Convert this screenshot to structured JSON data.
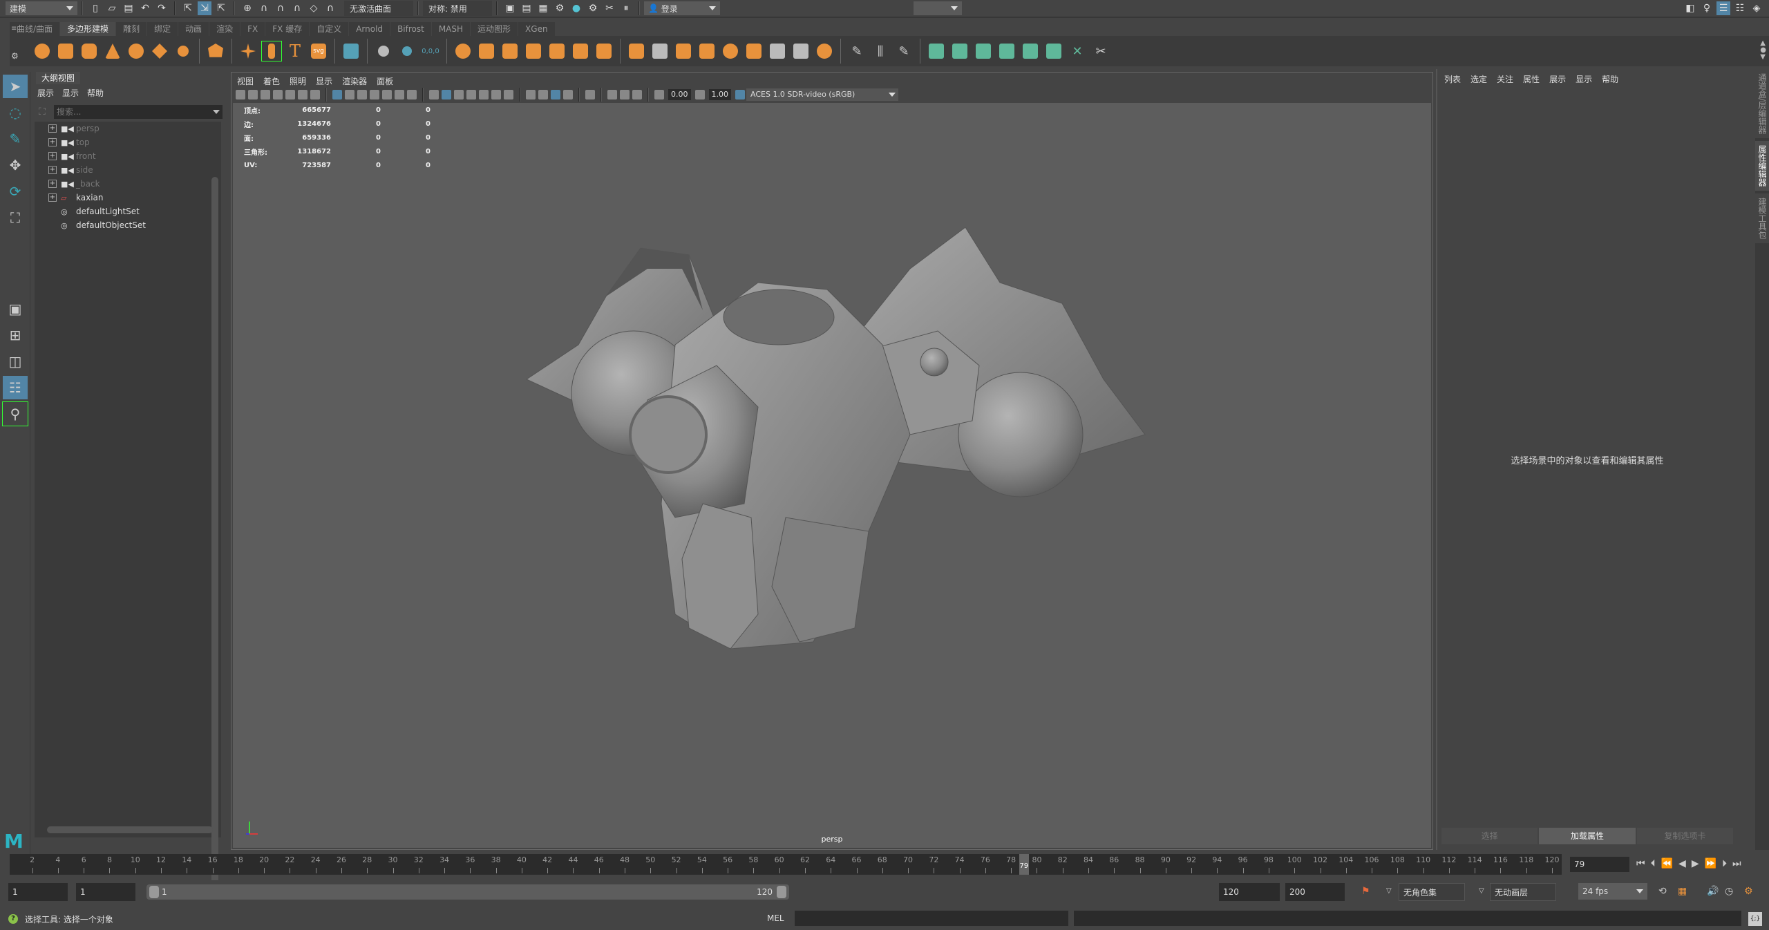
{
  "statusline": {
    "menu_set": "建模",
    "live_surface": "无激活曲面",
    "symmetry": "对称: 禁用",
    "login": "登录"
  },
  "shelf": {
    "tabs": [
      {
        "label": "曲线/曲面",
        "active": false
      },
      {
        "label": "多边形建模",
        "active": true
      },
      {
        "label": "雕刻",
        "active": false
      },
      {
        "label": "绑定",
        "active": false
      },
      {
        "label": "动画",
        "active": false
      },
      {
        "label": "渲染",
        "active": false
      },
      {
        "label": "FX",
        "active": false
      },
      {
        "label": "FX 缓存",
        "active": false
      },
      {
        "label": "自定义",
        "active": false
      },
      {
        "label": "Arnold",
        "active": false
      },
      {
        "label": "Bifrost",
        "active": false
      },
      {
        "label": "MASH",
        "active": false
      },
      {
        "label": "运动图形",
        "active": false
      },
      {
        "label": "XGen",
        "active": false
      }
    ],
    "text_icon": "T",
    "svg_icon": "svg"
  },
  "outliner": {
    "title": "大纲视图",
    "menu": [
      "展示",
      "显示",
      "帮助"
    ],
    "search_placeholder": "搜索...",
    "items": [
      {
        "label": "persp",
        "type": "camera",
        "dim": true
      },
      {
        "label": "top",
        "type": "camera",
        "dim": true
      },
      {
        "label": "front",
        "type": "camera",
        "dim": true
      },
      {
        "label": "side",
        "type": "camera",
        "dim": true
      },
      {
        "label": "_back",
        "type": "camera",
        "dim": true
      },
      {
        "label": "kaxian",
        "type": "transform",
        "dim": false
      },
      {
        "label": "defaultLightSet",
        "type": "set",
        "dim": false
      },
      {
        "label": "defaultObjectSet",
        "type": "set",
        "dim": false
      }
    ]
  },
  "viewport": {
    "menu": [
      "视图",
      "着色",
      "照明",
      "显示",
      "渲染器",
      "面板"
    ],
    "exposure": "0.00",
    "gamma": "1.00",
    "color_management": "ACES 1.0 SDR-video (sRGB)",
    "camera": "persp",
    "hud": [
      {
        "label": "顶点:",
        "value": "665677",
        "sel": "0",
        "tri": "0"
      },
      {
        "label": "边:",
        "value": "1324676",
        "sel": "0",
        "tri": "0"
      },
      {
        "label": "面:",
        "value": "659336",
        "sel": "0",
        "tri": "0"
      },
      {
        "label": "三角形:",
        "value": "1318672",
        "sel": "0",
        "tri": "0"
      },
      {
        "label": "UV:",
        "value": "723587",
        "sel": "0",
        "tri": "0"
      }
    ],
    "axis": {
      "x": "x",
      "y": "y",
      "z": "z"
    }
  },
  "attribute_editor": {
    "menu": [
      "列表",
      "选定",
      "关注",
      "属性",
      "展示",
      "显示",
      "帮助"
    ],
    "message": "选择场景中的对象以查看和编辑其属性",
    "buttons": [
      {
        "label": "选择",
        "active": false
      },
      {
        "label": "加载属性",
        "active": true
      },
      {
        "label": "复制选项卡",
        "active": false
      }
    ],
    "side_tabs": [
      {
        "label": "通道盒/层编辑器",
        "active": false
      },
      {
        "label": "属性编辑器",
        "active": true
      },
      {
        "label": "建模工具包",
        "active": false
      }
    ]
  },
  "timeslider": {
    "start": 1,
    "end": 120,
    "step": 2,
    "current_frame": "79",
    "frame_field": "79"
  },
  "rangeslider": {
    "anim_start": "1",
    "playback_start": "1",
    "range_start_label": "1",
    "range_end_label": "120",
    "playback_end": "120",
    "anim_end": "200",
    "character_set": "无角色集",
    "anim_layer": "无动画层",
    "fps": "24 fps"
  },
  "helpline": {
    "help_text": "选择工具: 选择一个对象",
    "mel_label": "MEL",
    "script_icon": "{;}"
  }
}
